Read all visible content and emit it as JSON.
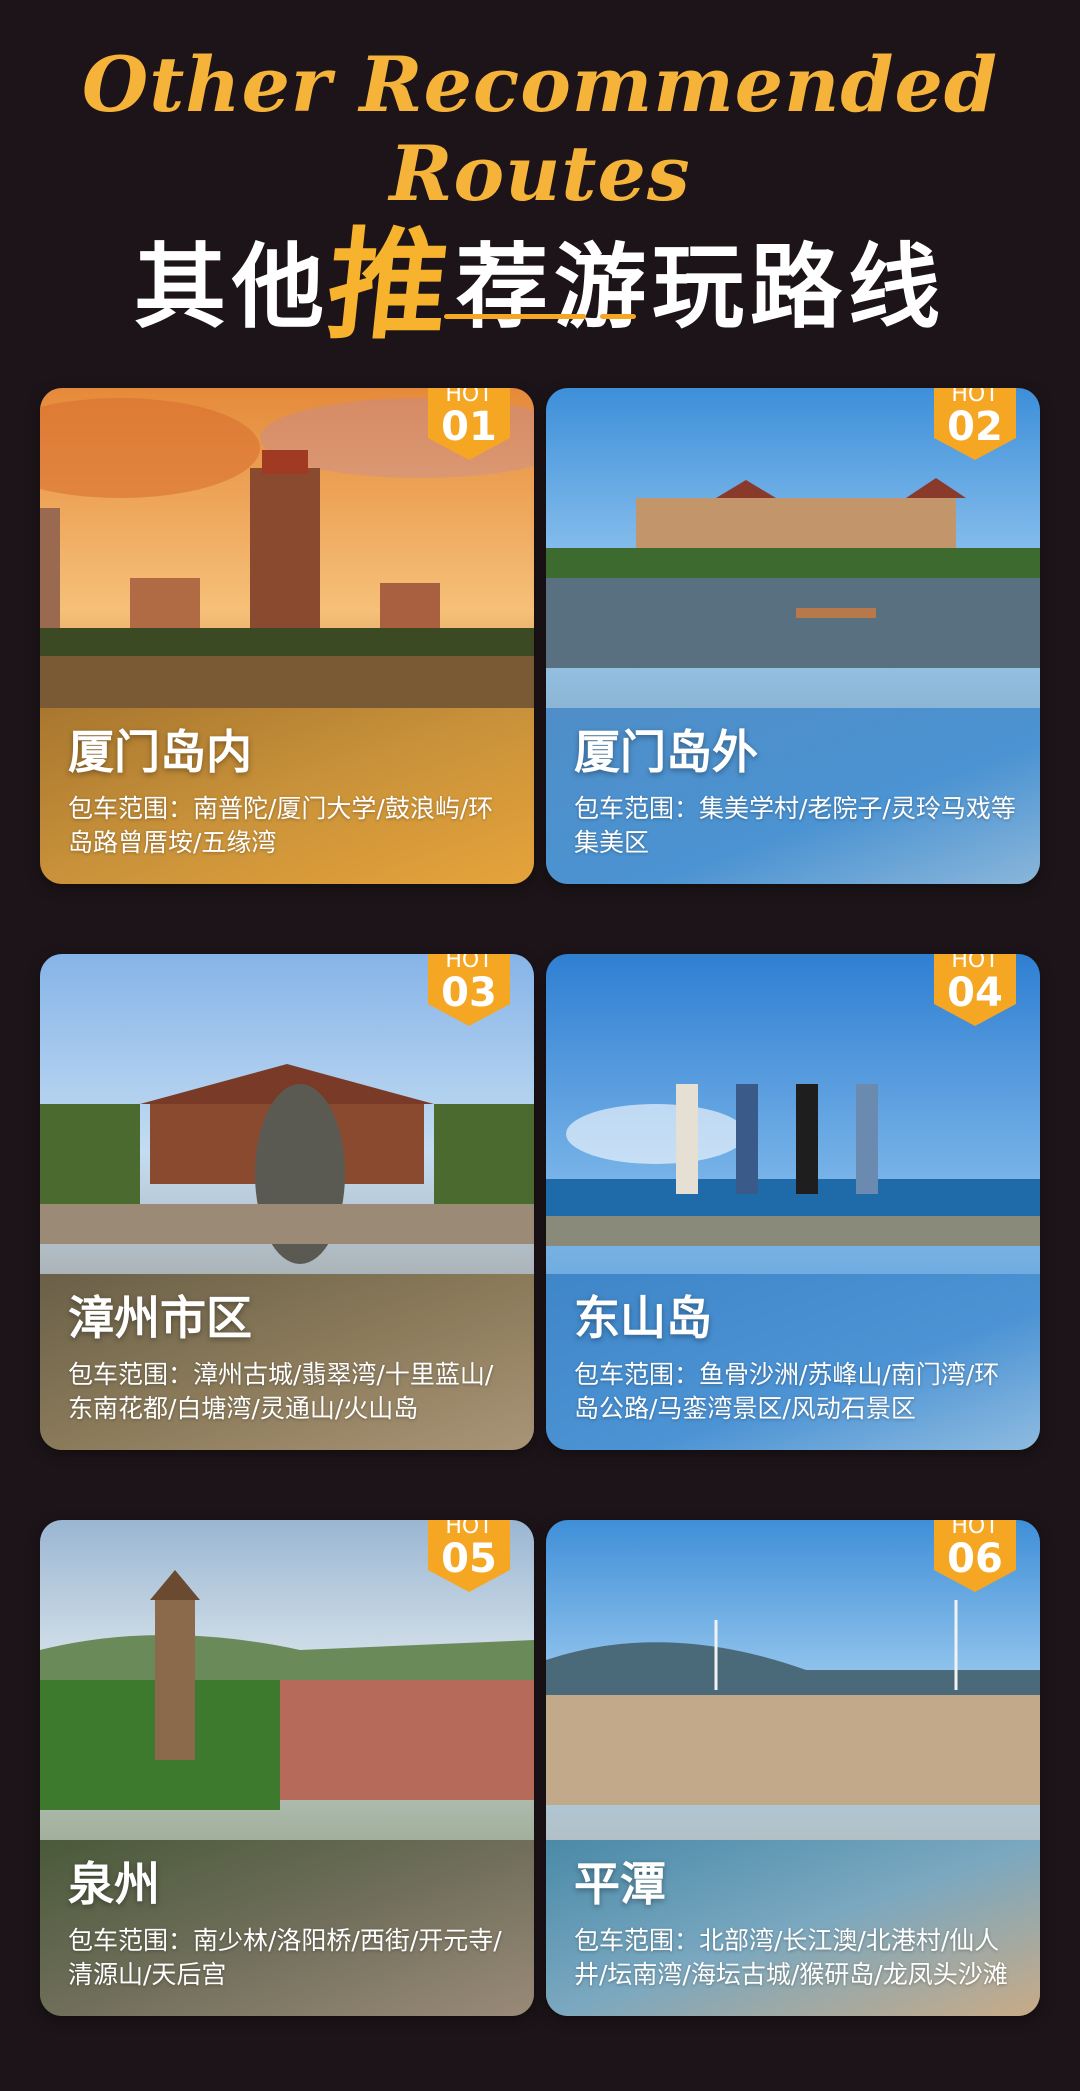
{
  "header": {
    "script_title": "Other Recommended Routes",
    "cn_title_pre": "其他",
    "cn_title_highlight": "推",
    "cn_title_post": "荐游玩路线"
  },
  "routes": [
    {
      "hot": "HOT",
      "num": "01",
      "title": "厦门岛内",
      "desc": "包车范围：南普陀/厦门大学/鼓浪屿/环岛路曾厝垵/五缘湾",
      "image": "tower-over-lake-sunset"
    },
    {
      "hot": "HOT",
      "num": "02",
      "title": "厦门岛外",
      "desc": "包车范围：集美学村/老院子/灵玲马戏等集美区",
      "image": "pagoda-buildings-by-water"
    },
    {
      "hot": "HOT",
      "num": "03",
      "title": "漳州市区",
      "desc": "包车范围：漳州古城/翡翠湾/十里蓝山/东南花都/白塘湾/灵通山/火山岛",
      "image": "temple-with-statue"
    },
    {
      "hot": "HOT",
      "num": "04",
      "title": "东山岛",
      "desc": "包车范围：鱼骨沙洲/苏峰山/南门湾/环岛公路/马銮湾景区/风动石景区",
      "image": "four-people-seawall"
    },
    {
      "hot": "HOT",
      "num": "05",
      "title": "泉州",
      "desc": "包车范围：南少林/洛阳桥/西街/开元寺/清源山/天后宫",
      "image": "stone-pagoda-over-city"
    },
    {
      "hot": "HOT",
      "num": "06",
      "title": "平潭",
      "desc": "包车范围：北部湾/长江澳/北港村/仙人井/坛南湾/海坛古城/猴研岛/龙凤头沙滩",
      "image": "wind-turbines-beach"
    }
  ],
  "colors": {
    "accent": "#f5a623",
    "background": "#1c1418",
    "badge": "#f5a623"
  }
}
